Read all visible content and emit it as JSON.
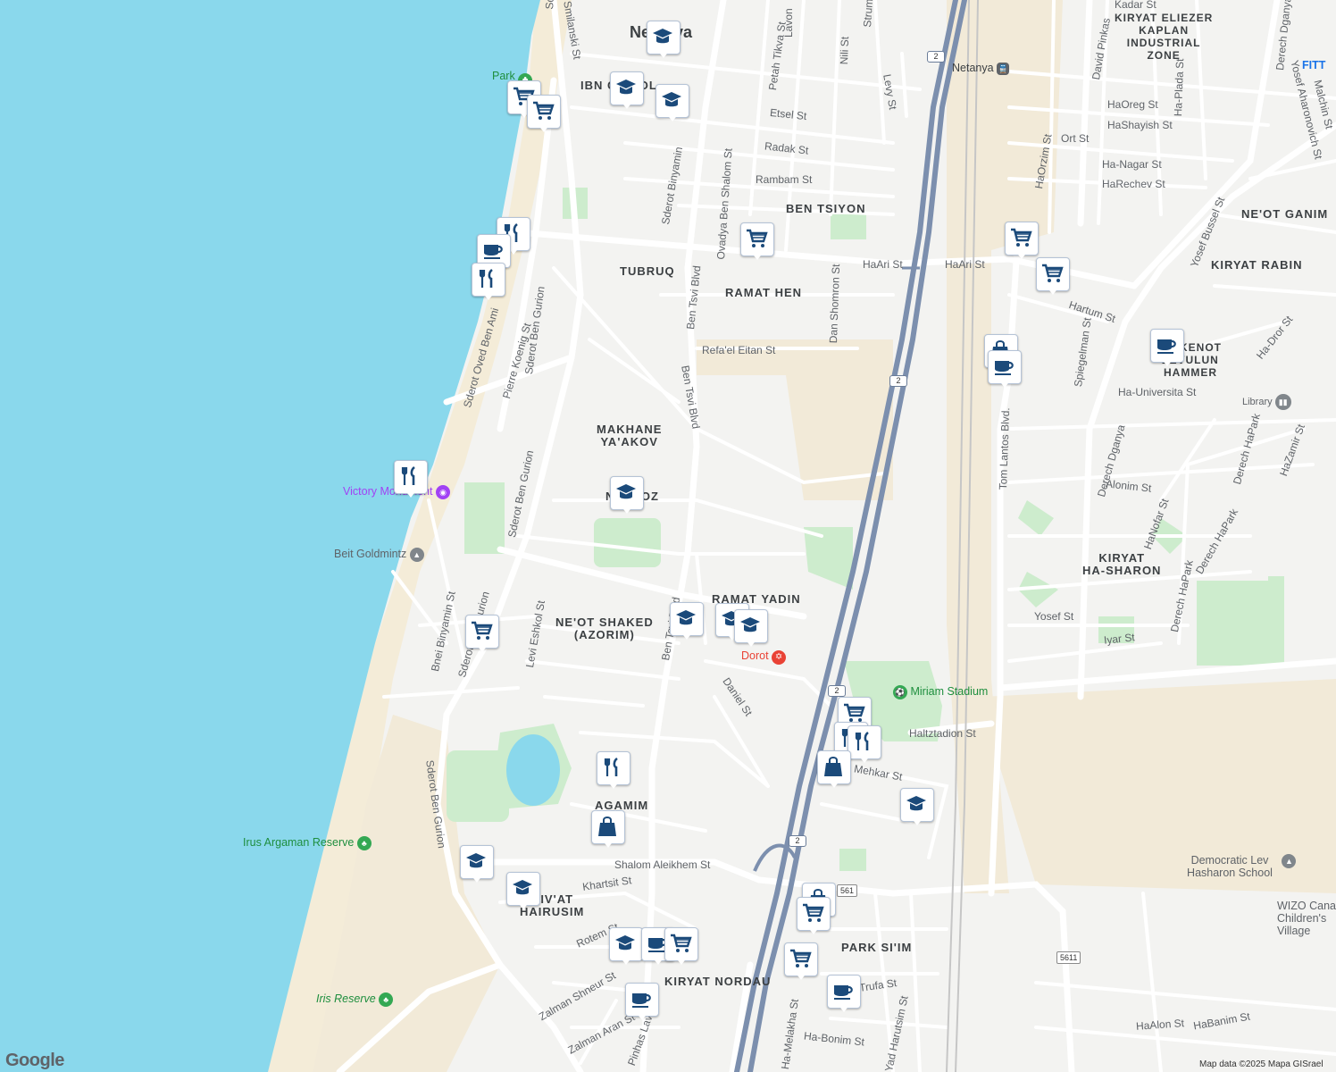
{
  "map": {
    "city_label": "Netanya",
    "attribution": "Map data ©2025 Mapa GISrael",
    "logo": "Google",
    "colors": {
      "sea": "#8ad8ec",
      "land": "#f3f3f1",
      "sand": "#f3ecdd",
      "park": "#cdeccd",
      "highway": "#7c8fae",
      "road": "#ffffff",
      "pin_icon": "#1b4a7a"
    },
    "neighborhoods": [
      {
        "name": "IBN GVIROL",
        "lines": [
          "IBN GVIROL"
        ]
      },
      {
        "name": "BEN TSIYON",
        "lines": [
          "BEN TSIYON"
        ]
      },
      {
        "name": "TUBRUQ",
        "lines": [
          "TUBRUQ"
        ]
      },
      {
        "name": "RAMAT HEN",
        "lines": [
          "RAMAT HEN"
        ]
      },
      {
        "name": "MAKHANE YA'AKOV",
        "lines": [
          "MAKHANE",
          "YA'AKOV"
        ]
      },
      {
        "name": "NIRA OZ",
        "lines": [
          "NIRA OZ"
        ]
      },
      {
        "name": "RAMAT YADIN",
        "lines": [
          "RAMAT YADIN"
        ]
      },
      {
        "name": "NE'OT SHAKED (AZORIM)",
        "lines": [
          "NE'OT SHAKED",
          "(AZORIM)"
        ]
      },
      {
        "name": "AGAMIM",
        "lines": [
          "AGAMIM"
        ]
      },
      {
        "name": "GIV'AT HAIRUSIM",
        "lines": [
          "GIV'AT",
          "HAIRUSIM"
        ]
      },
      {
        "name": "KIRYAT NORDAU",
        "lines": [
          "KIRYAT NORDAU"
        ]
      },
      {
        "name": "PARK SI'IM",
        "lines": [
          "PARK SI'IM"
        ]
      },
      {
        "name": "KIRYAT ELIEZER KAPLAN INDUSTRIAL ZONE",
        "lines": [
          "KIRYAT ELIEZER",
          "KAPLAN",
          "INDUSTRIAL",
          "ZONE"
        ]
      },
      {
        "name": "NE'OT GANIM",
        "lines": [
          "NE'OT GANIM"
        ]
      },
      {
        "name": "KIRYAT RABIN",
        "lines": [
          "KIRYAT RABIN"
        ]
      },
      {
        "name": "SHIKUN ZEVULUN HAMMER",
        "lines": [
          "SHIKENOT",
          "ZEVULUN",
          "HAMMER"
        ]
      },
      {
        "name": "KIRYAT HA-SHARON",
        "lines": [
          "KIRYAT",
          "HA-SHARON"
        ]
      }
    ],
    "streets": [
      "Sderot Jabotinsky",
      "Smilanski St",
      "Lavon",
      "Petah Tikva St",
      "Nili St",
      "Strum",
      "Etsel St",
      "Radak St",
      "Rambam St",
      "HaAri St",
      "HaAri St",
      "Ben Tsvi Blvd",
      "Ovadya Ben Shalom St",
      "Sderot Binyamin",
      "Refa'el Eitan St",
      "Dan Shomron St",
      "Ben Tsvi Blvd",
      "Ben Tsvi Blvd",
      "Sderot Ben Gurion",
      "Sderot Ben Gurion",
      "Sderot Ben Gurion",
      "Sderot Ben Gurion",
      "Pierre Koenig St",
      "Sderot Oved Ben Ami",
      "Bnei Binyamin St",
      "Levi Eshkol St",
      "Daniel St",
      "Haltztadion St",
      "Mehkar St",
      "Shalom Aleikhem St",
      "Khartsit St",
      "Rotem St",
      "Zalman Shneur St",
      "Zalman Aran St",
      "Pinhas Lavon",
      "Ha-Melakha St",
      "Ha-Bonim St",
      "Yad Harutsim St",
      "Trufa St",
      "HaAlon St",
      "HaBanim St",
      "HaOreg St",
      "HaShayish St",
      "Ha-Plada St",
      "Ort St",
      "Ha-Nagar St",
      "HaRechev St",
      "HaOrzim St",
      "David Pinkas",
      "Derech Dganya",
      "Derech Dganya",
      "Yosef Bussel St",
      "Hartum St",
      "Spiegelman St",
      "Ha-Universita St",
      "Tom Lantos Blvd.",
      "Derech HaPark",
      "Derech HaPark",
      "Derech HaPark",
      "HaZamir St",
      "Ha-Dror St",
      "Alonim St",
      "HaNofar St",
      "Yosef St",
      "Iyar St",
      "Yosef Aharonovich St",
      "Malchin St",
      "Levy St",
      "Kadar St"
    ],
    "places": [
      {
        "name": "Park",
        "kind": "park"
      },
      {
        "name": "Victory Monument",
        "kind": "attraction"
      },
      {
        "name": "Beit Goldmintz",
        "kind": "school"
      },
      {
        "name": "Dorot",
        "kind": "worship"
      },
      {
        "name": "Miriam Stadium",
        "kind": "stadium"
      },
      {
        "name": "Irus Argaman Reserve",
        "kind": "park"
      },
      {
        "name": "Iris Reserve",
        "kind": "park"
      },
      {
        "name": "Netanya",
        "kind": "train"
      },
      {
        "name": "Library",
        "kind": "library"
      },
      {
        "name": "Democratic Lev Hasharon School",
        "kind": "school"
      },
      {
        "name": "WIZO Canada Children's Village",
        "kind": "school"
      },
      {
        "name": "FITT",
        "kind": "business"
      }
    ],
    "highway_badges": [
      "2",
      "2",
      "2",
      "2"
    ],
    "route_badges": [
      "5611",
      "561"
    ],
    "pins": [
      {
        "icon": "school-icon"
      },
      {
        "icon": "school-icon"
      },
      {
        "icon": "school-icon"
      },
      {
        "icon": "cart-icon"
      },
      {
        "icon": "cart-icon"
      },
      {
        "icon": "restaurant-icon"
      },
      {
        "icon": "cafe-icon"
      },
      {
        "icon": "restaurant-icon"
      },
      {
        "icon": "cart-icon"
      },
      {
        "icon": "cart-icon"
      },
      {
        "icon": "cart-icon"
      },
      {
        "icon": "shopping-bag-icon"
      },
      {
        "icon": "cafe-icon"
      },
      {
        "icon": "cafe-icon"
      },
      {
        "icon": "restaurant-icon"
      },
      {
        "icon": "school-icon"
      },
      {
        "icon": "cart-icon"
      },
      {
        "icon": "school-icon"
      },
      {
        "icon": "school-icon"
      },
      {
        "icon": "school-icon"
      },
      {
        "icon": "cart-icon"
      },
      {
        "icon": "restaurant-icon"
      },
      {
        "icon": "restaurant-icon"
      },
      {
        "icon": "shopping-bag-icon"
      },
      {
        "icon": "school-icon"
      },
      {
        "icon": "restaurant-icon"
      },
      {
        "icon": "shopping-bag-icon"
      },
      {
        "icon": "school-icon"
      },
      {
        "icon": "school-icon"
      },
      {
        "icon": "school-icon"
      },
      {
        "icon": "cafe-icon"
      },
      {
        "icon": "cart-icon"
      },
      {
        "icon": "cafe-icon"
      },
      {
        "icon": "shopping-bag-icon"
      },
      {
        "icon": "cart-icon"
      },
      {
        "icon": "cart-icon"
      },
      {
        "icon": "cafe-icon"
      }
    ]
  }
}
